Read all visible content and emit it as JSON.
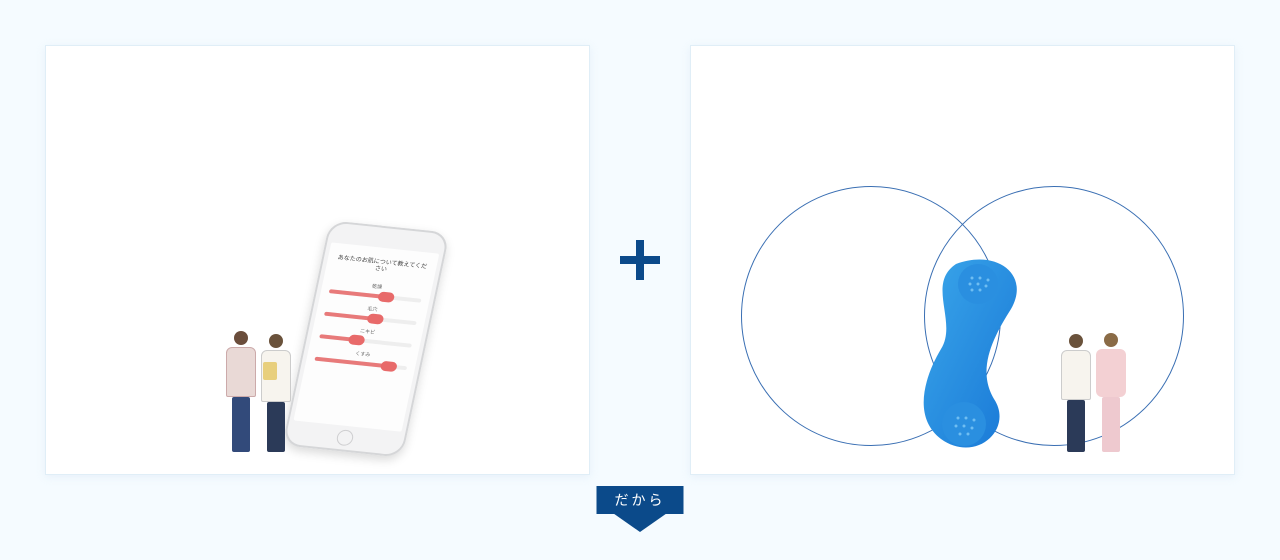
{
  "plus_symbol": "+",
  "ribbon_label": "だから",
  "smartphone": {
    "title": "あなたのお肌について教えてください",
    "rows": [
      {
        "label": "乾燥",
        "value_percent": 62
      },
      {
        "label": "毛穴",
        "value_percent": 55
      },
      {
        "label": "ニキビ",
        "value_percent": 40
      },
      {
        "label": "くすみ",
        "value_percent": 80
      }
    ]
  },
  "icons": {
    "plus": "plus-icon",
    "down_arrow": "down-arrow-icon",
    "phone_handset": "phone-handset-icon"
  }
}
